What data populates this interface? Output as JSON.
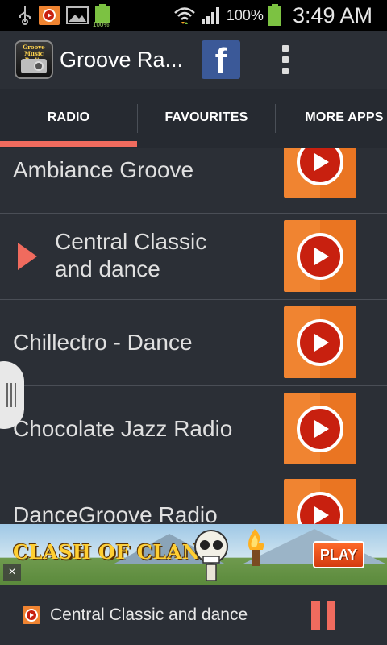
{
  "status_bar": {
    "battery_percent": "100%",
    "small_battery_label": "100%",
    "time": "3:49 AM",
    "icons": [
      "usb-icon",
      "media-play-icon",
      "image-icon",
      "battery-small-icon",
      "wifi-icon",
      "signal-icon",
      "battery-icon"
    ]
  },
  "action_bar": {
    "app_title": "Groove Ra...",
    "logo_text": "Groove Music Radio",
    "facebook_label": "f"
  },
  "tabs": [
    {
      "label": "RADIO",
      "active": true
    },
    {
      "label": "FAVOURITES",
      "active": false
    },
    {
      "label": "MORE APPS",
      "active": false
    }
  ],
  "stations": [
    {
      "name": "Ambiance Groove",
      "playing": false
    },
    {
      "name": "Central Classic and dance",
      "line1": "Central Classic",
      "line2": "and dance",
      "playing": true
    },
    {
      "name": "Chillectro - Dance",
      "playing": false
    },
    {
      "name": "Chocolate Jazz Radio",
      "playing": false
    },
    {
      "name": "DanceGroove Radio",
      "playing": false
    }
  ],
  "ad": {
    "logo_text": "CLASH OF CLANS",
    "play_label": "PLAY",
    "close_label": "×"
  },
  "player": {
    "now_playing": "Central Classic and dance"
  },
  "colors": {
    "accent": "#f06b5e",
    "play_button": "#f08431",
    "play_circle": "#c8200f",
    "background": "#2b2f36"
  }
}
